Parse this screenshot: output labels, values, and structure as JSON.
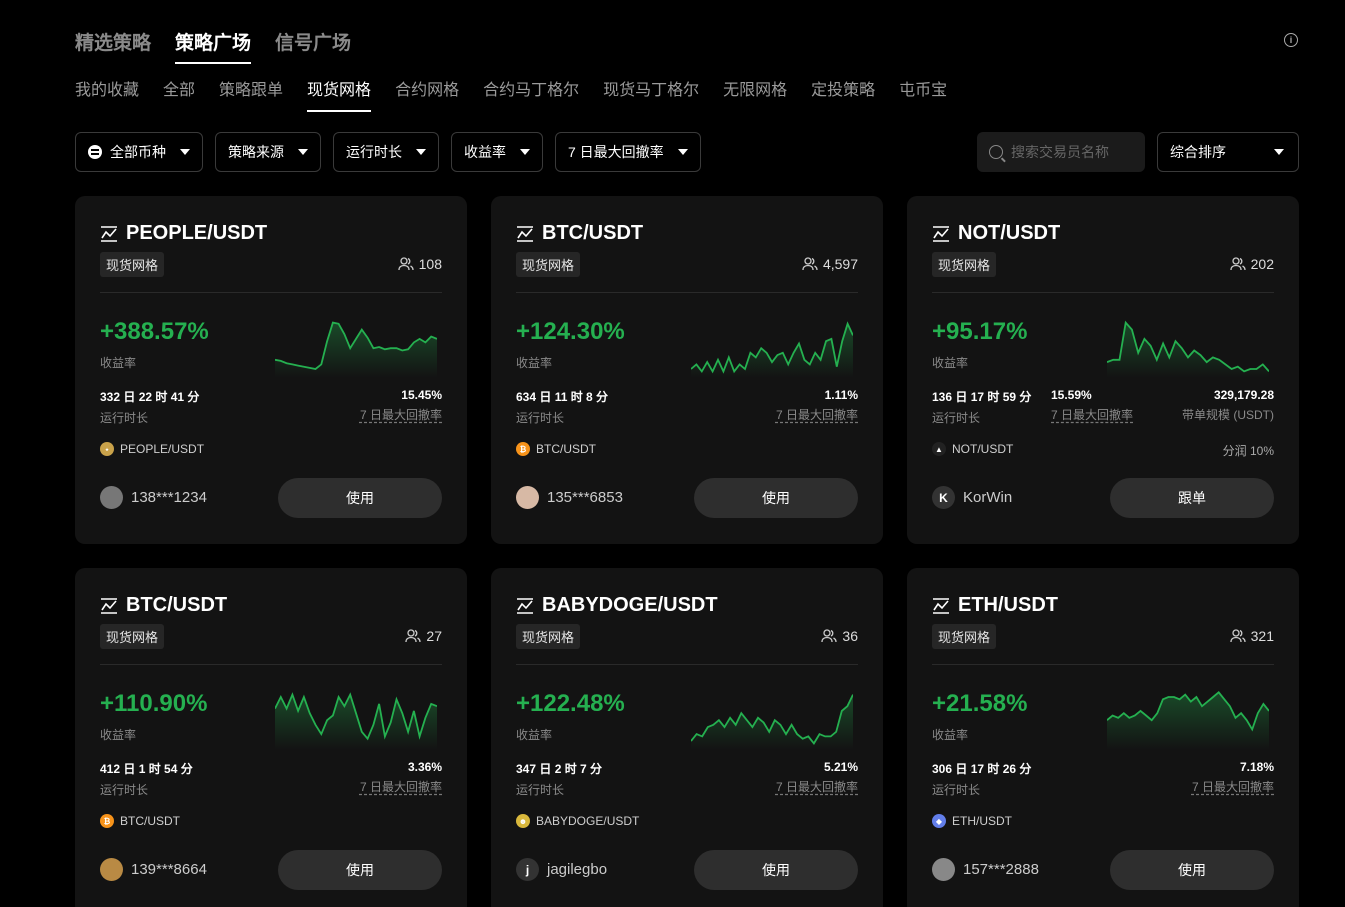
{
  "header": {
    "tabs": [
      {
        "label": "精选策略"
      },
      {
        "label": "策略广场"
      },
      {
        "label": "信号广场"
      }
    ],
    "info_icon": "info-icon"
  },
  "sub_tabs": [
    {
      "label": "我的收藏"
    },
    {
      "label": "全部"
    },
    {
      "label": "策略跟单"
    },
    {
      "label": "现货网格"
    },
    {
      "label": "合约网格"
    },
    {
      "label": "合约马丁格尔"
    },
    {
      "label": "现货马丁格尔"
    },
    {
      "label": "无限网格"
    },
    {
      "label": "定投策略"
    },
    {
      "label": "屯币宝"
    }
  ],
  "filters": {
    "coins": "全部币种",
    "source": "策略来源",
    "duration": "运行时长",
    "roi": "收益率",
    "drawdown": "7 日最大回撤率"
  },
  "search": {
    "placeholder": "搜索交易员名称"
  },
  "sort": {
    "label": "综合排序"
  },
  "colors": {
    "positive": "#25b050",
    "background": "#000000",
    "card": "#131313"
  },
  "cards": [
    {
      "pair": "PEOPLE/USDT",
      "tag": "现货网格",
      "users": "108",
      "roi": "+388.57%",
      "roi_label": "收益率",
      "runtime": "332 日 22 时 41 分",
      "runtime_label": "运行时长",
      "drawdown": "15.45%",
      "drawdown_label": "7 日最大回撤率",
      "coin": "PEOPLE/USDT",
      "coin_icon": "people-coin-icon",
      "trader": "138***1234",
      "button": "使用",
      "spark": [
        36,
        37,
        39,
        40,
        41,
        42,
        43,
        44,
        40,
        20,
        4,
        5,
        14,
        26,
        18,
        10,
        17,
        26,
        25,
        27,
        26,
        26,
        28,
        27,
        21,
        18,
        21,
        16,
        18
      ]
    },
    {
      "pair": "BTC/USDT",
      "tag": "现货网格",
      "users": "4,597",
      "roi": "+124.30%",
      "roi_label": "收益率",
      "runtime": "634 日 11 时 8 分",
      "runtime_label": "运行时长",
      "drawdown": "1.11%",
      "drawdown_label": "7 日最大回撤率",
      "coin": "BTC/USDT",
      "coin_icon": "btc-coin-icon",
      "trader": "135***6853",
      "button": "使用",
      "spark": [
        44,
        40,
        46,
        38,
        46,
        36,
        46,
        34,
        46,
        40,
        44,
        30,
        34,
        26,
        30,
        38,
        32,
        30,
        40,
        30,
        22,
        36,
        40,
        30,
        36,
        20,
        18,
        42,
        20,
        5,
        15
      ]
    },
    {
      "pair": "NOT/USDT",
      "tag": "现货网格",
      "users": "202",
      "roi": "+95.17%",
      "roi_label": "收益率",
      "runtime": "136 日 17 时 59 分",
      "runtime_label": "运行时长",
      "drawdown": "15.59%",
      "drawdown_label": "7 日最大回撤率",
      "volume": "329,179.28",
      "volume_label": "带单规模 (USDT)",
      "profit_share": "分润 10%",
      "coin": "NOT/USDT",
      "coin_icon": "not-coin-icon",
      "trader": "KorWin",
      "button": "跟单",
      "spark": [
        38,
        36,
        36,
        4,
        10,
        30,
        18,
        24,
        36,
        22,
        34,
        20,
        26,
        34,
        28,
        32,
        38,
        34,
        36,
        40,
        44,
        42,
        46,
        44,
        44,
        40,
        46
      ]
    },
    {
      "pair": "BTC/USDT",
      "tag": "现货网格",
      "users": "27",
      "roi": "+110.90%",
      "roi_label": "收益率",
      "runtime": "412 日 1 时 54 分",
      "runtime_label": "运行时长",
      "drawdown": "3.36%",
      "drawdown_label": "7 日最大回撤率",
      "coin": "BTC/USDT",
      "coin_icon": "btc-coin-icon",
      "trader": "139***8664",
      "button": "使用",
      "spark": [
        16,
        6,
        16,
        4,
        18,
        6,
        20,
        30,
        38,
        26,
        22,
        6,
        14,
        4,
        20,
        36,
        42,
        30,
        12,
        40,
        28,
        8,
        20,
        36,
        18,
        40,
        24,
        12,
        14
      ]
    },
    {
      "pair": "BABYDOGE/USDT",
      "tag": "现货网格",
      "users": "36",
      "roi": "+122.48%",
      "roi_label": "收益率",
      "runtime": "347 日 2 时 7 分",
      "runtime_label": "运行时长",
      "drawdown": "5.21%",
      "drawdown_label": "7 日最大回撤率",
      "coin": "BABYDOGE/USDT",
      "coin_icon": "babydoge-coin-icon",
      "trader": "jagilegbo",
      "button": "使用",
      "spark": [
        44,
        38,
        40,
        32,
        30,
        26,
        32,
        24,
        30,
        20,
        26,
        32,
        24,
        28,
        36,
        26,
        30,
        38,
        30,
        38,
        42,
        40,
        46,
        38,
        40,
        40,
        36,
        18,
        14,
        4
      ]
    },
    {
      "pair": "ETH/USDT",
      "tag": "现货网格",
      "users": "321",
      "roi": "+21.58%",
      "roi_label": "收益率",
      "runtime": "306 日 17 时 26 分",
      "runtime_label": "运行时长",
      "drawdown": "7.18%",
      "drawdown_label": "7 日最大回撤率",
      "coin": "ETH/USDT",
      "coin_icon": "eth-coin-icon",
      "trader": "157***2888",
      "button": "使用",
      "spark": [
        26,
        22,
        24,
        20,
        24,
        22,
        18,
        22,
        26,
        20,
        8,
        6,
        6,
        8,
        4,
        10,
        6,
        14,
        10,
        6,
        2,
        8,
        14,
        24,
        20,
        26,
        34,
        20,
        12,
        18
      ]
    }
  ]
}
